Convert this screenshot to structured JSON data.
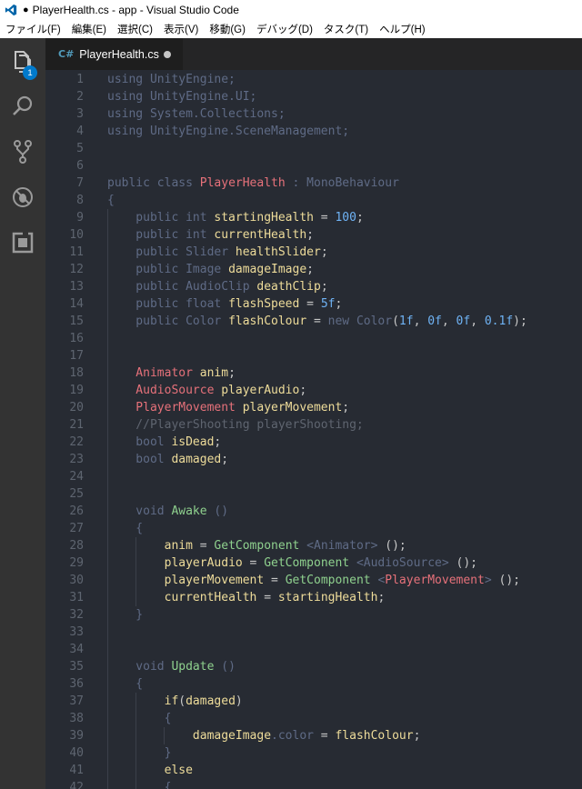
{
  "window": {
    "title": "PlayerHealth.cs - app - Visual Studio Code",
    "unsaved_marker": "●"
  },
  "menu": [
    "ファイル(F)",
    "編集(E)",
    "選択(C)",
    "表示(V)",
    "移動(G)",
    "デバッグ(D)",
    "タスク(T)",
    "ヘルプ(H)"
  ],
  "activity_bar": {
    "items": [
      "explorer-icon",
      "search-icon",
      "source-control-icon",
      "debug-icon",
      "extensions-icon"
    ],
    "explorer_badge": "1"
  },
  "tab": {
    "label": "PlayerHealth.cs",
    "icon_text": "C#"
  },
  "colors": {
    "keyword": "#5f6b86",
    "type": "#c5c8c6",
    "name": "#e6a27a",
    "class": "#e6717a",
    "number": "#6fb3f5",
    "function": "#8fd18e",
    "identifier": "#eedc9a",
    "comment": "#5f6570"
  },
  "code_lines": [
    [
      [
        "kw",
        "using UnityEngine;"
      ]
    ],
    [
      [
        "kw",
        "using UnityEngine.UI;"
      ]
    ],
    [
      [
        "kw",
        "using System.Collections;"
      ]
    ],
    [
      [
        "kw",
        "using UnityEngine.SceneManagement;"
      ]
    ],
    [],
    [],
    [
      [
        "kw",
        "public "
      ],
      [
        "kw",
        "class "
      ],
      [
        "cl",
        "PlayerHealth"
      ],
      [
        "kw",
        " : MonoBehaviour"
      ]
    ],
    [
      [
        "kw",
        "{"
      ]
    ],
    [
      [
        "kw",
        "    public "
      ],
      [
        "kw",
        "int "
      ],
      [
        "id",
        "startingHealth"
      ],
      [
        "pl",
        " = "
      ],
      [
        "num",
        "100"
      ],
      [
        "pl",
        ";"
      ]
    ],
    [
      [
        "kw",
        "    public "
      ],
      [
        "kw",
        "int "
      ],
      [
        "id",
        "currentHealth"
      ],
      [
        "pl",
        ";"
      ]
    ],
    [
      [
        "kw",
        "    public "
      ],
      [
        "kw",
        "Slider "
      ],
      [
        "id",
        "healthSlider"
      ],
      [
        "pl",
        ";"
      ]
    ],
    [
      [
        "kw",
        "    public "
      ],
      [
        "kw",
        "Image "
      ],
      [
        "id",
        "damageImage"
      ],
      [
        "pl",
        ";"
      ]
    ],
    [
      [
        "kw",
        "    public "
      ],
      [
        "kw",
        "AudioClip "
      ],
      [
        "id",
        "deathClip"
      ],
      [
        "pl",
        ";"
      ]
    ],
    [
      [
        "kw",
        "    public "
      ],
      [
        "kw",
        "float "
      ],
      [
        "id",
        "flashSpeed"
      ],
      [
        "pl",
        " = "
      ],
      [
        "num",
        "5f"
      ],
      [
        "pl",
        ";"
      ]
    ],
    [
      [
        "kw",
        "    public "
      ],
      [
        "kw",
        "Color "
      ],
      [
        "id",
        "flashColour"
      ],
      [
        "pl",
        " = "
      ],
      [
        "kw",
        "new "
      ],
      [
        "kw",
        "Color"
      ],
      [
        "pl",
        "("
      ],
      [
        "num",
        "1f"
      ],
      [
        "pl",
        ", "
      ],
      [
        "num",
        "0f"
      ],
      [
        "pl",
        ", "
      ],
      [
        "num",
        "0f"
      ],
      [
        "pl",
        ", "
      ],
      [
        "num",
        "0.1f"
      ],
      [
        "pl",
        ");"
      ]
    ],
    [],
    [],
    [
      [
        "cl",
        "    Animator "
      ],
      [
        "id",
        "anim"
      ],
      [
        "pl",
        ";"
      ]
    ],
    [
      [
        "cl",
        "    AudioSource "
      ],
      [
        "id",
        "playerAudio"
      ],
      [
        "pl",
        ";"
      ]
    ],
    [
      [
        "cl",
        "    PlayerMovement "
      ],
      [
        "id",
        "playerMovement"
      ],
      [
        "pl",
        ";"
      ]
    ],
    [
      [
        "cm",
        "    //PlayerShooting playerShooting;"
      ]
    ],
    [
      [
        "kw",
        "    bool "
      ],
      [
        "id",
        "isDead"
      ],
      [
        "pl",
        ";"
      ]
    ],
    [
      [
        "kw",
        "    bool "
      ],
      [
        "id",
        "damaged"
      ],
      [
        "pl",
        ";"
      ]
    ],
    [],
    [],
    [
      [
        "kw",
        "    void "
      ],
      [
        "fn",
        "Awake"
      ],
      [
        "kw",
        " ()"
      ]
    ],
    [
      [
        "kw",
        "    {"
      ]
    ],
    [
      [
        "pl",
        "        "
      ],
      [
        "id",
        "anim"
      ],
      [
        "pl",
        " = "
      ],
      [
        "fn",
        "GetComponent "
      ],
      [
        "kw",
        "<Animator>"
      ],
      [
        "pl",
        " ();"
      ]
    ],
    [
      [
        "pl",
        "        "
      ],
      [
        "id",
        "playerAudio"
      ],
      [
        "pl",
        " = "
      ],
      [
        "fn",
        "GetComponent "
      ],
      [
        "kw",
        "<AudioSource>"
      ],
      [
        "pl",
        " ();"
      ]
    ],
    [
      [
        "pl",
        "        "
      ],
      [
        "id",
        "playerMovement"
      ],
      [
        "pl",
        " = "
      ],
      [
        "fn",
        "GetComponent "
      ],
      [
        "kw",
        "<"
      ],
      [
        "cl",
        "PlayerMovement"
      ],
      [
        "kw",
        ">"
      ],
      [
        "pl",
        " ();"
      ]
    ],
    [
      [
        "pl",
        "        "
      ],
      [
        "id",
        "currentHealth"
      ],
      [
        "pl",
        " = "
      ],
      [
        "id",
        "startingHealth"
      ],
      [
        "pl",
        ";"
      ]
    ],
    [
      [
        "kw",
        "    }"
      ]
    ],
    [],
    [],
    [
      [
        "kw",
        "    void "
      ],
      [
        "fn",
        "Update"
      ],
      [
        "kw",
        " ()"
      ]
    ],
    [
      [
        "kw",
        "    {"
      ]
    ],
    [
      [
        "id",
        "        if"
      ],
      [
        "pl",
        "("
      ],
      [
        "id",
        "damaged"
      ],
      [
        "pl",
        ")"
      ]
    ],
    [
      [
        "kw",
        "        {"
      ]
    ],
    [
      [
        "pl",
        "            "
      ],
      [
        "id",
        "damageImage"
      ],
      [
        "kw",
        ".color"
      ],
      [
        "pl",
        " = "
      ],
      [
        "id",
        "flashColour"
      ],
      [
        "pl",
        ";"
      ]
    ],
    [
      [
        "kw",
        "        }"
      ]
    ],
    [
      [
        "id",
        "        else"
      ]
    ],
    [
      [
        "kw",
        "        {"
      ]
    ]
  ]
}
